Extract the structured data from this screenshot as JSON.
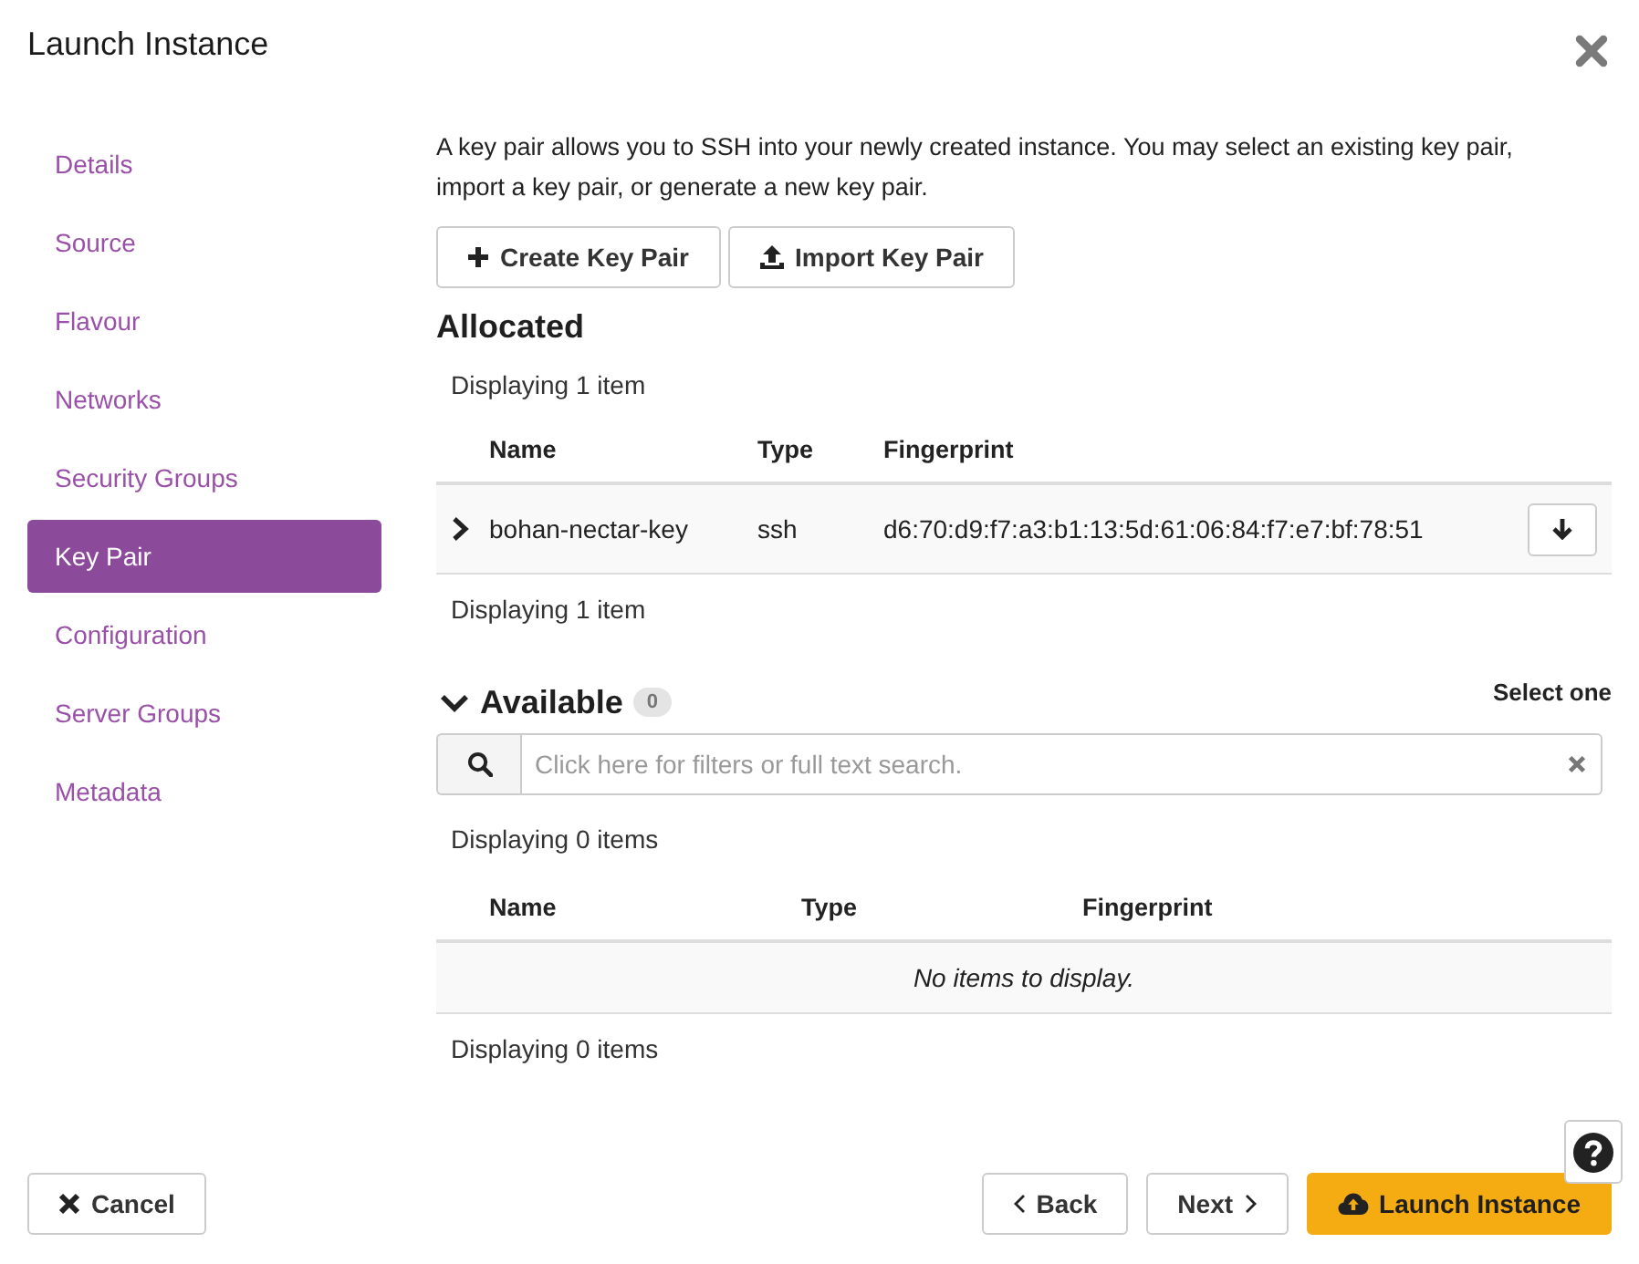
{
  "window": {
    "title": "Launch Instance"
  },
  "sidebar": {
    "items": [
      {
        "label": "Details",
        "selected": false
      },
      {
        "label": "Source",
        "selected": false
      },
      {
        "label": "Flavour",
        "selected": false
      },
      {
        "label": "Networks",
        "selected": false
      },
      {
        "label": "Security Groups",
        "selected": false
      },
      {
        "label": "Key Pair",
        "selected": true
      },
      {
        "label": "Configuration",
        "selected": false
      },
      {
        "label": "Server Groups",
        "selected": false
      },
      {
        "label": "Metadata",
        "selected": false
      }
    ]
  },
  "description": "A key pair allows you to SSH into your newly created instance. You may select an existing key pair, import a key pair, or generate a new key pair.",
  "actions": [
    {
      "label": "Create Key Pair",
      "kind": "create"
    },
    {
      "label": "Import Key Pair",
      "kind": "import"
    }
  ],
  "allocated": {
    "heading": "Allocated",
    "count_top": "Displaying 1 item",
    "columns": [
      "Name",
      "Type",
      "Fingerprint"
    ],
    "rows": [
      {
        "name": "bohan-nectar-key",
        "type": "ssh",
        "fingerprint": "d6:70:d9:f7:a3:b1:13:5d:61:06:84:f7:e7:bf:78:51",
        "expanded": false
      }
    ],
    "count_bottom": "Displaying 1 item"
  },
  "available": {
    "heading": "Available",
    "expanded": true,
    "badge": "0",
    "hint": "Select one",
    "search": {
      "placeholder": "Click here for filters or full text search."
    },
    "count_top": "Displaying 0 items",
    "columns": [
      "Name",
      "Type",
      "Fingerprint"
    ],
    "empty_message": "No items to display.",
    "count_bottom": "Displaying 0 items"
  },
  "footer": {
    "buttons": [
      {
        "label": "Cancel",
        "kind": "cancel"
      },
      {
        "label": "Back",
        "kind": "back"
      },
      {
        "label": "Next",
        "kind": "next"
      },
      {
        "label": "Launch Instance",
        "kind": "primary"
      }
    ]
  }
}
